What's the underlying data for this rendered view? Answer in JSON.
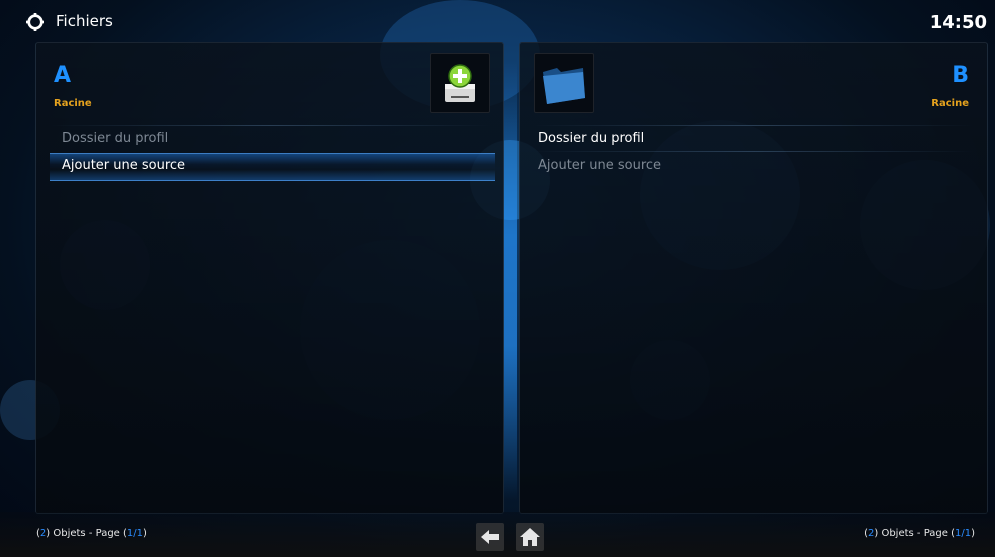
{
  "header": {
    "title": "Fichiers",
    "clock": "14:50",
    "app_icon": "gear-icon"
  },
  "panel_a": {
    "letter": "A",
    "path": "Racine",
    "thumb_icon": "add-drive-icon",
    "items": [
      {
        "label": "Dossier du profil"
      },
      {
        "label": "Ajouter une source"
      }
    ],
    "status": {
      "count": "2",
      "prefix": ") Objets - Page (",
      "page": "1/1",
      "suffix": ")"
    }
  },
  "panel_b": {
    "letter": "B",
    "path": "Racine",
    "thumb_icon": "folder-icon",
    "items": [
      {
        "label": "Dossier du profil"
      },
      {
        "label": "Ajouter une source"
      }
    ],
    "status": {
      "count": "2",
      "prefix": ") Objets - Page (",
      "page": "1/1",
      "suffix": ")"
    }
  },
  "nav": {
    "back_icon": "back-arrow-icon",
    "home_icon": "home-icon"
  },
  "colors": {
    "accent_blue": "#1e90ff",
    "path_orange": "#e5a21e",
    "add_green": "#8cd63a"
  }
}
